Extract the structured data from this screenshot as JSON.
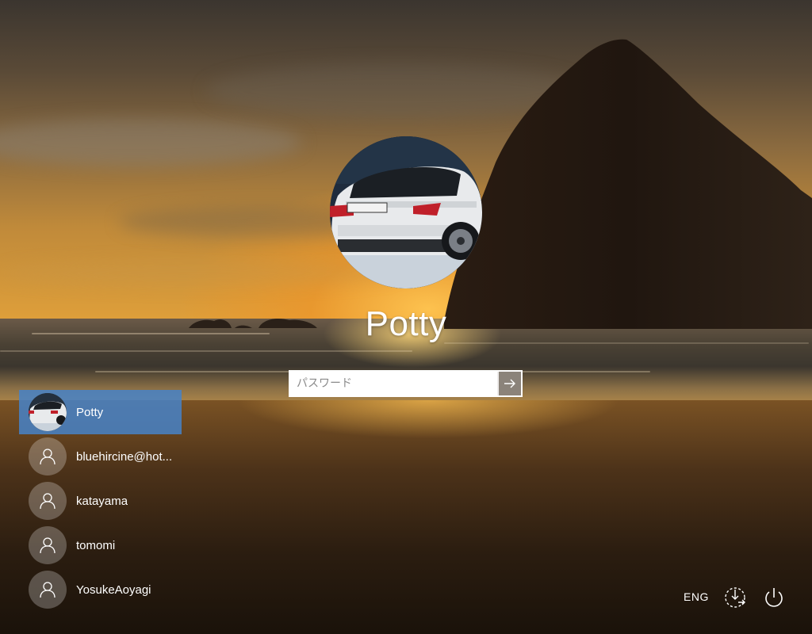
{
  "login": {
    "selected_user": "Potty",
    "password_placeholder": "パスワード",
    "password_value": "",
    "submit_icon": "arrow-right-icon"
  },
  "users": [
    {
      "name": "Potty",
      "avatar": "car-photo",
      "selected": true
    },
    {
      "name": "bluehircine@hot...",
      "avatar": "person-icon",
      "selected": false
    },
    {
      "name": "katayama",
      "avatar": "person-icon",
      "selected": false
    },
    {
      "name": "tomomi",
      "avatar": "person-icon",
      "selected": false
    },
    {
      "name": "YosukeAoyagi",
      "avatar": "person-icon",
      "selected": false
    }
  ],
  "tray": {
    "language": "ENG",
    "accessibility_icon": "ease-of-access-icon",
    "power_icon": "power-icon"
  },
  "colors": {
    "selection": "#4682c8",
    "submit_button": "#786e64",
    "text": "#ffffff"
  }
}
